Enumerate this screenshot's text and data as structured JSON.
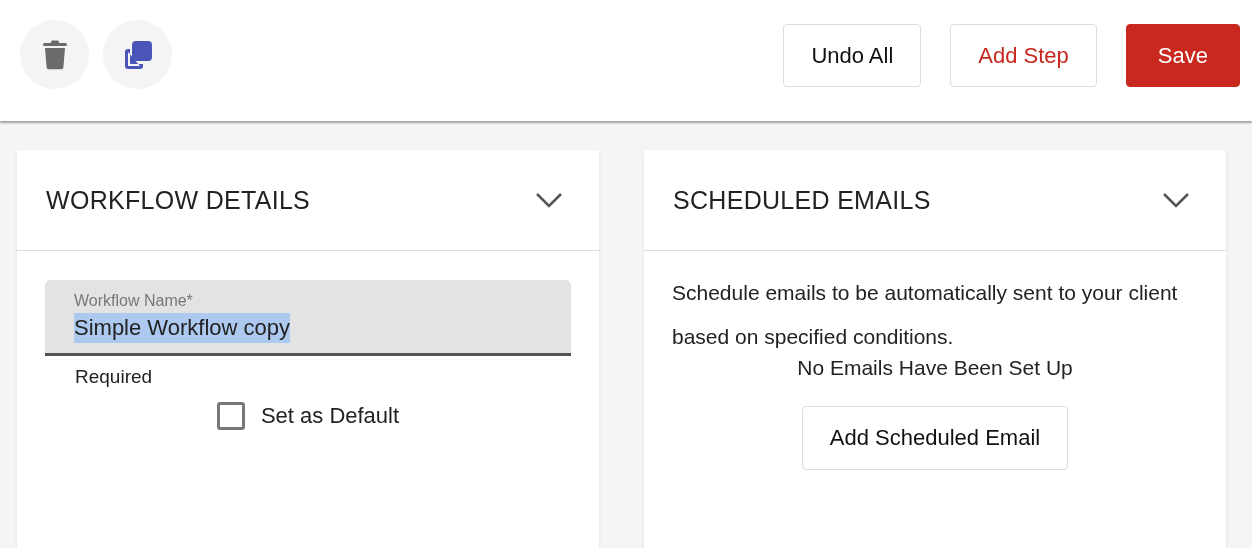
{
  "toolbar": {
    "icon_buttons": [
      {
        "kind": "delete"
      },
      {
        "kind": "copy"
      }
    ],
    "buttons": [
      {
        "label": "Undo All",
        "kind": "plain"
      },
      {
        "label": "Add Step",
        "kind": "outline-accent"
      },
      {
        "label": "Save",
        "kind": "primary"
      }
    ]
  },
  "workflow_details": {
    "title": "WORKFLOW DETAILS",
    "expanded": true,
    "name_field": {
      "label": "Workflow Name*",
      "value": "Simple Workflow copy",
      "text_selected": true,
      "helper": "Required"
    },
    "default_checkbox": {
      "label": "Set as Default",
      "checked": false
    }
  },
  "scheduled_emails": {
    "title": "SCHEDULED EMAILS",
    "expanded": true,
    "description": "Schedule emails to be automatically sent to your client based on specified conditions.",
    "empty_message": "No Emails Have Been Set Up",
    "button": "Add Scheduled Email"
  }
}
